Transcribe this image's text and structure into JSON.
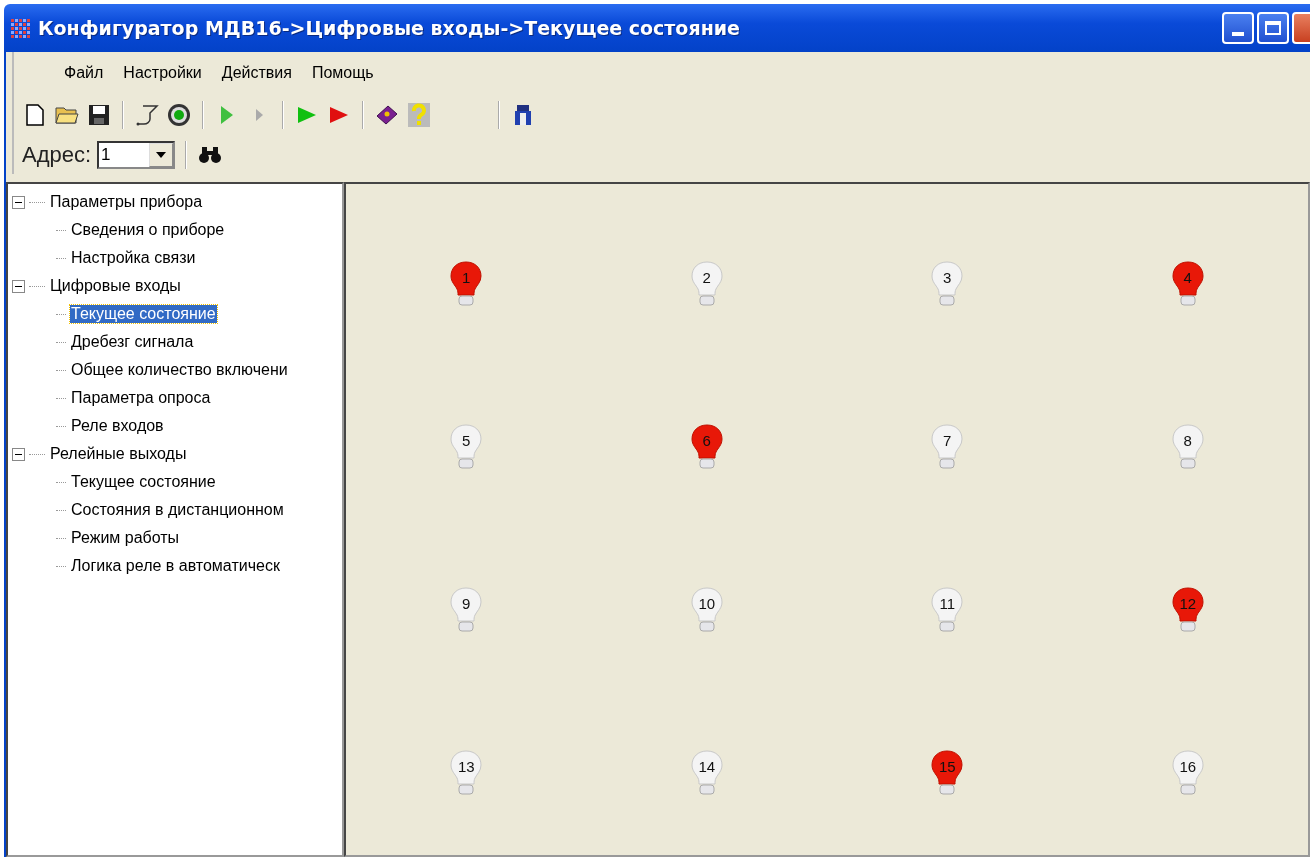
{
  "window": {
    "title": "Конфигуратор МДВ16->Цифровые входы->Текущее состояние"
  },
  "menu": [
    "Файл",
    "Настройки",
    "Действия",
    "Помощь"
  ],
  "address": {
    "label": "Адрес:",
    "value": "1"
  },
  "tree": [
    {
      "label": "Параметры прибора",
      "expanded": true,
      "selected": false,
      "children": [
        {
          "label": "Сведения о приборе",
          "selected": false
        },
        {
          "label": "Настройка связи",
          "selected": false
        }
      ]
    },
    {
      "label": "Цифровые входы",
      "expanded": true,
      "selected": false,
      "children": [
        {
          "label": "Текущее состояние",
          "selected": true
        },
        {
          "label": "Дребезг сигнала",
          "selected": false
        },
        {
          "label": "Общее количество включени",
          "selected": false
        },
        {
          "label": "Параметра опроса",
          "selected": false
        },
        {
          "label": "Реле входов",
          "selected": false
        }
      ]
    },
    {
      "label": "Релейные выходы",
      "expanded": true,
      "selected": false,
      "children": [
        {
          "label": "Текущее состояние",
          "selected": false
        },
        {
          "label": "Состояния в дистанционном",
          "selected": false
        },
        {
          "label": "Режим работы",
          "selected": false
        },
        {
          "label": "Логика реле в автоматическ",
          "selected": false
        }
      ]
    }
  ],
  "lamps": [
    {
      "label": "1",
      "on": true
    },
    {
      "label": "2",
      "on": false
    },
    {
      "label": "3",
      "on": false
    },
    {
      "label": "4",
      "on": true
    },
    {
      "label": "5",
      "on": false
    },
    {
      "label": "6",
      "on": true
    },
    {
      "label": "7",
      "on": false
    },
    {
      "label": "8",
      "on": false
    },
    {
      "label": "9",
      "on": false
    },
    {
      "label": "10",
      "on": false
    },
    {
      "label": "11",
      "on": false
    },
    {
      "label": "12",
      "on": true
    },
    {
      "label": "13",
      "on": false
    },
    {
      "label": "14",
      "on": false
    },
    {
      "label": "15",
      "on": true
    },
    {
      "label": "16",
      "on": false
    }
  ]
}
